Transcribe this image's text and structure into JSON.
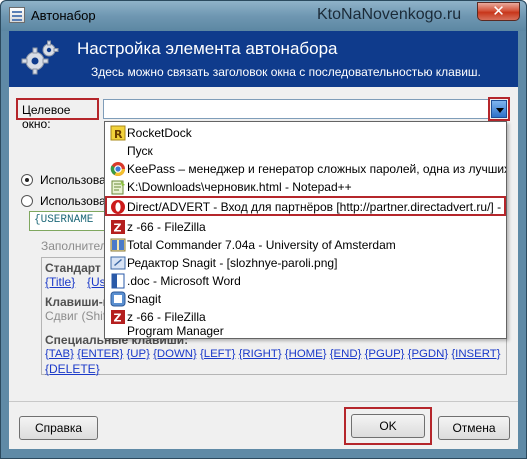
{
  "window": {
    "title": "Автонабор",
    "watermark": "KtoNaNovenkogo.ru",
    "close_glyph": "✕"
  },
  "header": {
    "title": "Настройка элемента автонабора",
    "subtitle": "Здесь можно связать заголовок окна с последовательностью клавиш."
  },
  "form": {
    "target_label": "Целевое окно:",
    "target_value": "",
    "option1_label": "Использова",
    "option2_label": "Использова",
    "username_snippet": "{USERNAME",
    "fill_label": "Заполнител",
    "standard_title": "Стандарт",
    "standard_links": [
      "{Title}",
      "{User"
    ],
    "keys_title": "Клавиши-м",
    "keys_grey": "Сдвиг (Shift)",
    "special_title": "Специальные клавиши:",
    "special_links_line1": [
      "{TAB}",
      "{ENTER}",
      "{UP}",
      "{DOWN}",
      "{LEFT}",
      "{RIGHT}",
      "{HOME}",
      "{END}",
      "{PGUP}",
      "{PGDN}",
      "{INSERT}"
    ],
    "special_links_line2": [
      "{DELETE}"
    ]
  },
  "buttons": {
    "help": "Справка",
    "ok": "OK",
    "cancel": "Отмена"
  },
  "dropdown": {
    "items": [
      {
        "icon": "rocketdock-icon",
        "label": "RocketDock"
      },
      {
        "icon": "blank-icon",
        "label": "Пуск"
      },
      {
        "icon": "chrome-icon",
        "label": "KeePass – менеджер и генератор сложных паролей, одна из лучших пр..."
      },
      {
        "icon": "notepadpp-icon",
        "label": "K:\\Downloads\\черновик.html - Notepad++"
      },
      {
        "icon": "opera-icon",
        "label": "Direct/ADVERT - Вход для партнёров [http://partner.directadvert.ru/] - Opera"
      },
      {
        "icon": "filezilla-icon",
        "label": "z                  -66 - FileZilla"
      },
      {
        "icon": "totalcommander-icon",
        "label": "Total Commander 7.04a - University of Amsterdam"
      },
      {
        "icon": "snagit-editor-icon",
        "label": "Редактор Snagit - [slozhnye-paroli.png]"
      },
      {
        "icon": "word-icon",
        "label": "                                 .doc - Microsoft Word"
      },
      {
        "icon": "snagit-icon",
        "label": "Snagit"
      },
      {
        "icon": "filezilla-icon",
        "label": "z                    -66 - FileZilla"
      },
      {
        "icon": "blank-icon",
        "label": "Program Manager"
      }
    ]
  },
  "colors": {
    "header_bg": "#0f3b8c",
    "highlight_frame": "#b5262b",
    "link": "#1a39c9"
  }
}
